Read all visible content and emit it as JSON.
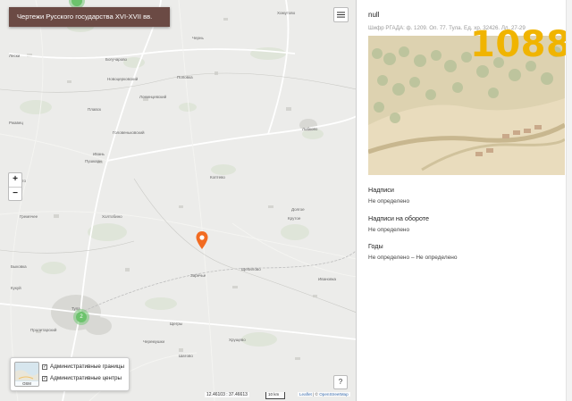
{
  "map": {
    "title": "Чертежи Русского государства XVI-XVII вв.",
    "zoom_in": "+",
    "zoom_out": "−",
    "help": "?",
    "coords": "12.46103 : 37.46613",
    "scale": "10 km",
    "attribution_leaflet": "Leaflet",
    "attribution_sep": " | © ",
    "attribution_osm": "OpenStreetMap",
    "basemap_label": "OSM",
    "layers": [
      {
        "label": "Административные границы",
        "checked": "✓"
      },
      {
        "label": "Административные центры",
        "checked": "✓"
      }
    ],
    "clusters": [
      {
        "count": ""
      },
      {
        "count": "2"
      }
    ],
    "places": [
      "Хомутово",
      "Чернь",
      "Поповка",
      "Лески",
      "Плавск",
      "Ивань",
      "Ломинцевский",
      "Ржавец",
      "Пушкари",
      "Головеньковский",
      "Новоцерковский",
      "Богучарово",
      "Болото",
      "Коптево",
      "Гремячее",
      "Холтобино",
      "Крутое",
      "Долгое",
      "Щепилово",
      "Заречье",
      "Тула",
      "Пролетарский",
      "Ивановка",
      "Быковка",
      "Кукуй",
      "Черемушки",
      "Шатово",
      "Щегры",
      "Хрущево",
      "Лобково"
    ],
    "marker_color": "#f26b21",
    "title_bg": "#6b4a44"
  },
  "panel": {
    "title": "null",
    "cipher": "Шифр РГАДА: ф. 1209. Оп. 77. Тула. Ед. хр. 32426. Лл. 27-29",
    "counter": "1088",
    "sections": [
      {
        "label": "Надписи",
        "value": "Не определено"
      },
      {
        "label": "Надписи на обороте",
        "value": "Не определено"
      },
      {
        "label": "Годы",
        "value": "Не определено – Не определено"
      }
    ],
    "counter_color": "#f0b400"
  }
}
